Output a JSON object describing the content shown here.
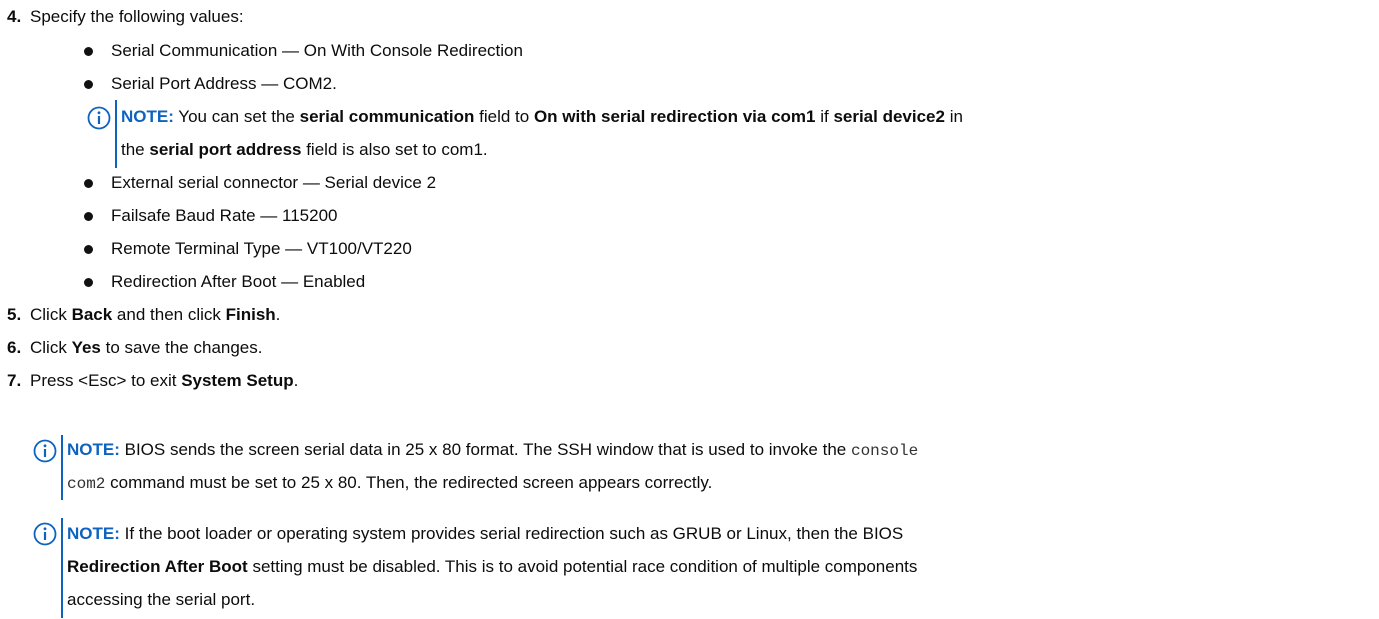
{
  "step4": {
    "number": "4.",
    "text": "Specify the following values:"
  },
  "values": [
    "Serial Communication — On With Console Redirection",
    "Serial Port Address — COM2.",
    "External serial connector — Serial device 2",
    "Failsafe Baud Rate — 115200",
    "Remote Terminal Type — VT100/VT220",
    "Redirection After Boot — Enabled"
  ],
  "note_label": "NOTE:",
  "note1": {
    "t1": " You can set the ",
    "b1": "serial communication",
    "t2": " field to ",
    "b2": "On with serial redirection via com1",
    "t3": " if ",
    "b3": "serial device2",
    "t4": " in",
    "t5": "the ",
    "b4": "serial port address",
    "t6": " field is also set to com1."
  },
  "step5": {
    "number": "5.",
    "t1": "Click ",
    "b1": "Back",
    "t2": " and then click ",
    "b2": "Finish",
    "t3": "."
  },
  "step6": {
    "number": "6.",
    "t1": "Click ",
    "b1": "Yes",
    "t2": " to save the changes."
  },
  "step7": {
    "number": "7.",
    "t1": "Press <Esc> to exit ",
    "b1": "System Setup",
    "t2": "."
  },
  "note2": {
    "t1": " BIOS sends the screen serial data in 25 x 80 format. The SSH window that is used to invoke the ",
    "code1": "console",
    "code2": "com2",
    "t2": " command must be set to 25 x 80. Then, the redirected screen appears correctly."
  },
  "note3": {
    "t1": " If the boot loader or operating system provides serial redirection such as GRUB or Linux, then the BIOS",
    "b1": "Redirection After Boot",
    "t2": " setting must be disabled. This is to avoid potential race condition of multiple components",
    "t3": "accessing the serial port."
  },
  "icon_name": "info-icon",
  "accent_color": "#0e63bf"
}
